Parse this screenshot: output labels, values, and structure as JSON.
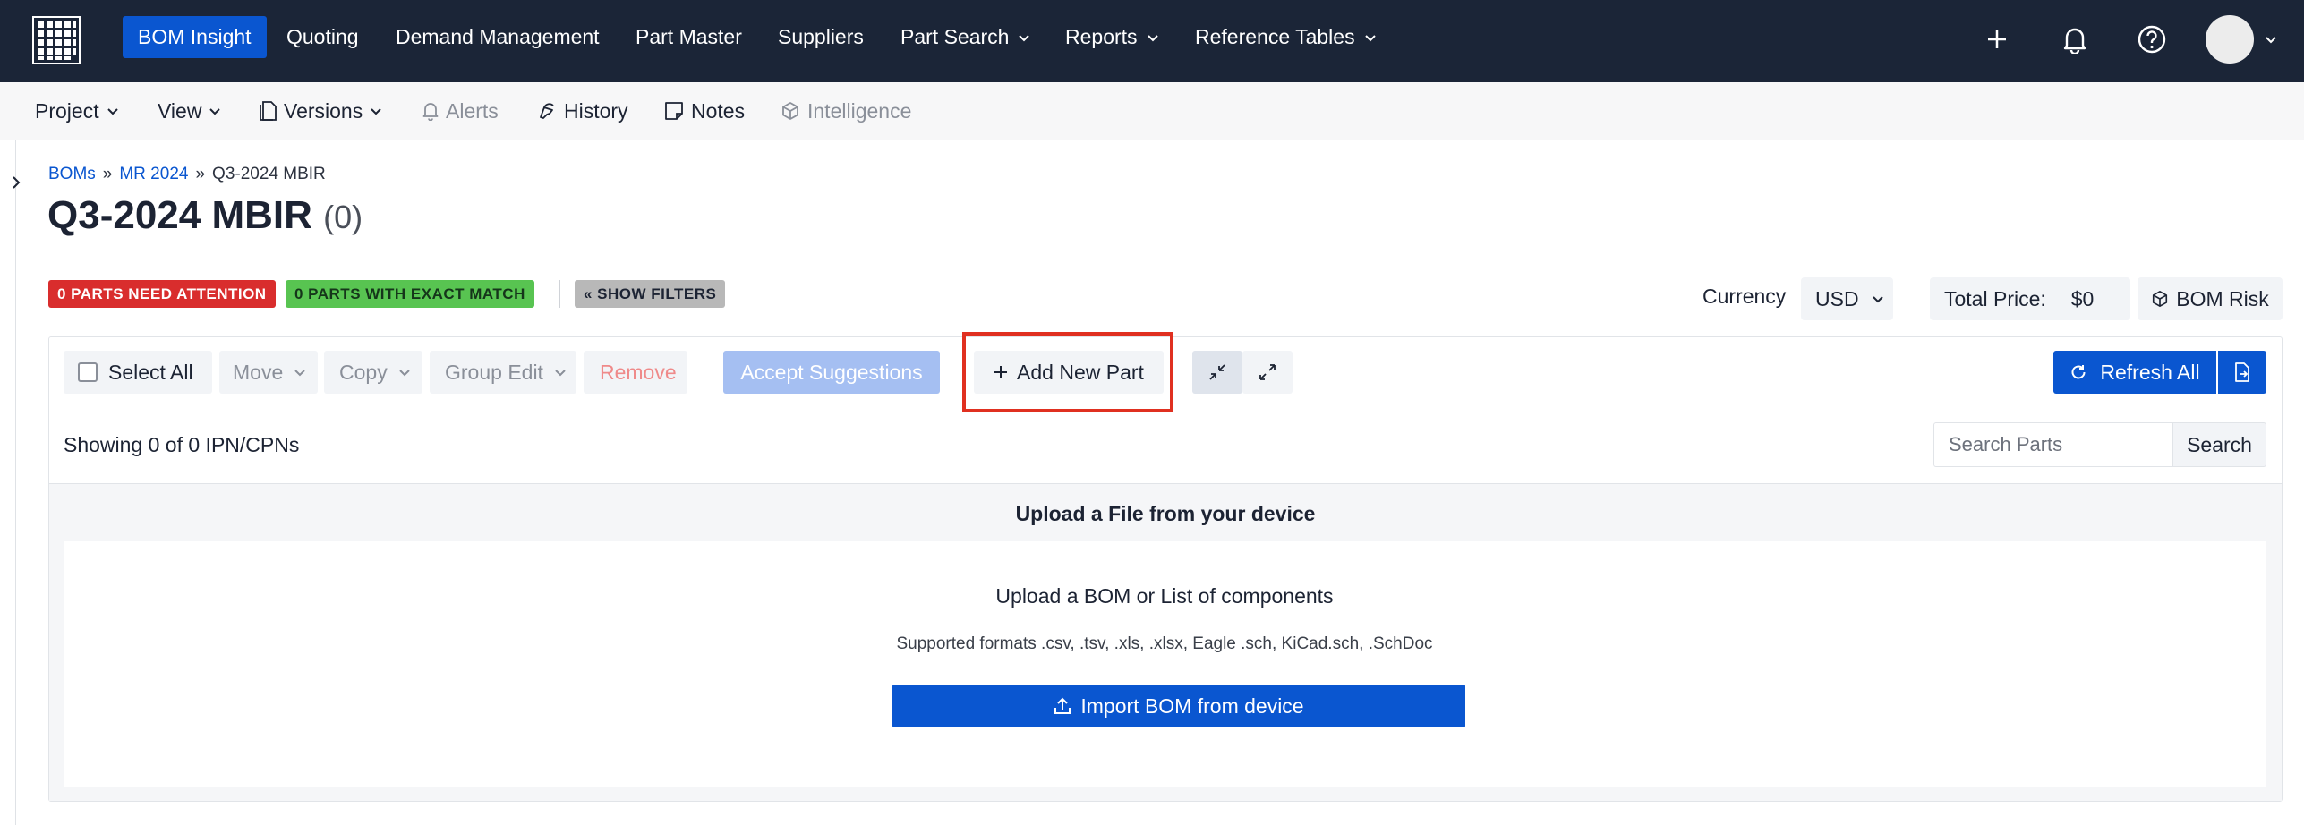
{
  "topnav": {
    "items": [
      {
        "label": "BOM Insight",
        "active": true
      },
      {
        "label": "Quoting"
      },
      {
        "label": "Demand Management"
      },
      {
        "label": "Part Master"
      },
      {
        "label": "Suppliers"
      },
      {
        "label": "Part Search",
        "dropdown": true
      },
      {
        "label": "Reports",
        "dropdown": true
      },
      {
        "label": "Reference Tables",
        "dropdown": true
      }
    ],
    "icons": [
      "plus-icon",
      "bell-icon",
      "help-icon",
      "avatar"
    ]
  },
  "subnav": {
    "items": [
      {
        "label": "Project",
        "dropdown": true
      },
      {
        "label": "View",
        "dropdown": true
      },
      {
        "label": "Versions",
        "dropdown": true,
        "icon": "versions-icon"
      },
      {
        "label": "Alerts",
        "disabled": true,
        "icon": "bell-icon"
      },
      {
        "label": "History",
        "icon": "history-icon"
      },
      {
        "label": "Notes",
        "icon": "notes-icon"
      },
      {
        "label": "Intelligence",
        "disabled": true,
        "icon": "cube-icon"
      }
    ]
  },
  "breadcrumb": {
    "boms": "BOMs",
    "sep": "»",
    "project": "MR 2024",
    "current": "Q3-2024 MBIR"
  },
  "page": {
    "title": "Q3-2024 MBIR",
    "count": "(0)"
  },
  "badges": {
    "attention": "0 PARTS NEED ATTENTION",
    "exact_match": "0 PARTS WITH EXACT MATCH",
    "filters": "« SHOW FILTERS"
  },
  "currency": {
    "label": "Currency",
    "value": "USD"
  },
  "total": {
    "label": "Total Price:",
    "value": "$0"
  },
  "bom_risk": "BOM Risk",
  "toolbar": {
    "select_all": "Select All",
    "move": "Move",
    "copy": "Copy",
    "group_edit": "Group Edit",
    "remove": "Remove",
    "accept_suggestions": "Accept Suggestions",
    "add_new_part": "Add New Part",
    "refresh_all": "Refresh All"
  },
  "list": {
    "showing": "Showing 0 of 0 IPN/CPNs",
    "search_placeholder": "Search Parts",
    "search_button": "Search"
  },
  "upload": {
    "header": "Upload a File from your device",
    "title": "Upload a BOM or List of components",
    "formats": "Supported formats .csv, .tsv, .xls, .xlsx, Eagle .sch, KiCad.sch, .SchDoc",
    "import_button": "Import BOM from device"
  },
  "colors": {
    "nav_bg": "#1b2537",
    "primary": "#0a56d0",
    "danger": "#d92d2d",
    "success": "#58c451",
    "highlight": "#e03020"
  }
}
